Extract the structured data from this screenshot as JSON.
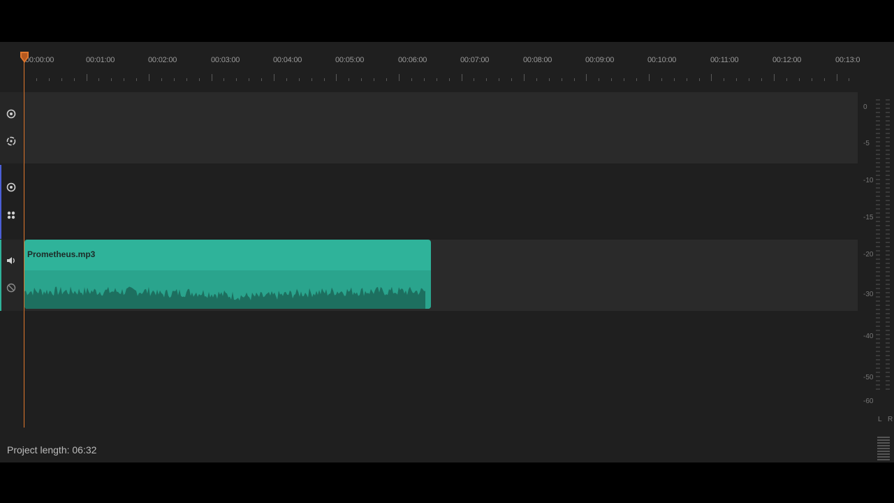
{
  "ruler": {
    "labels": [
      "00:00:00",
      "00:01:00",
      "00:02:00",
      "00:03:00",
      "00:04:00",
      "00:05:00",
      "00:06:00",
      "00:07:00",
      "00:08:00",
      "00:09:00",
      "00:10:00",
      "00:11:00",
      "00:12:00",
      "00:13:0"
    ]
  },
  "tracks": [
    {
      "id": "video-track-1",
      "icons": [
        "eye-icon",
        "lock-icon"
      ],
      "accent": "#4a4a4a"
    },
    {
      "id": "video-track-2",
      "icons": [
        "eye-icon",
        "effects-icon"
      ],
      "accent": "#4b5fd6"
    },
    {
      "id": "audio-track-1",
      "icons": [
        "speaker-icon",
        "link-icon"
      ],
      "accent": "#2fb39a"
    }
  ],
  "clip": {
    "name": "Prometheus.mp3",
    "color": "#2fb39a",
    "wave_color": "#1d6f5f"
  },
  "meter": {
    "labels": [
      "0",
      "-5",
      "-10",
      "-15",
      "-20",
      "-30",
      "-40",
      "-50",
      "-60"
    ],
    "channels": [
      "L",
      "R"
    ]
  },
  "footer": {
    "project_length": "Project length: 06:32"
  },
  "colors": {
    "playhead": "#e0782e",
    "background": "#1f1f1f"
  }
}
